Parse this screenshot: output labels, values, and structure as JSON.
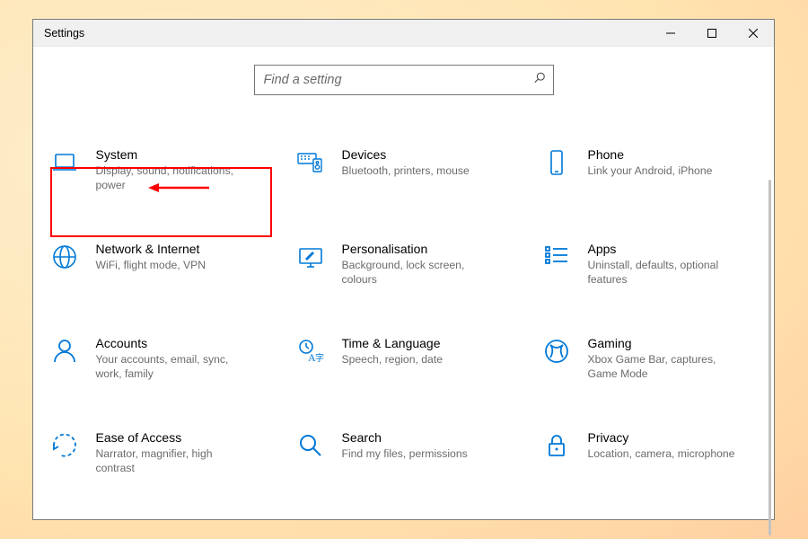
{
  "window": {
    "title": "Settings"
  },
  "search": {
    "placeholder": "Find a setting"
  },
  "tiles": [
    {
      "id": "system",
      "title": "System",
      "sub": "Display, sound, notifications, power"
    },
    {
      "id": "devices",
      "title": "Devices",
      "sub": "Bluetooth, printers, mouse"
    },
    {
      "id": "phone",
      "title": "Phone",
      "sub": "Link your Android, iPhone"
    },
    {
      "id": "network",
      "title": "Network & Internet",
      "sub": "WiFi, flight mode, VPN"
    },
    {
      "id": "personalisation",
      "title": "Personalisation",
      "sub": "Background, lock screen, colours"
    },
    {
      "id": "apps",
      "title": "Apps",
      "sub": "Uninstall, defaults, optional features"
    },
    {
      "id": "accounts",
      "title": "Accounts",
      "sub": "Your accounts, email, sync, work, family"
    },
    {
      "id": "time",
      "title": "Time & Language",
      "sub": "Speech, region, date"
    },
    {
      "id": "gaming",
      "title": "Gaming",
      "sub": "Xbox Game Bar, captures, Game Mode"
    },
    {
      "id": "ease",
      "title": "Ease of Access",
      "sub": "Narrator, magnifier, high contrast"
    },
    {
      "id": "search-cat",
      "title": "Search",
      "sub": "Find my files, permissions"
    },
    {
      "id": "privacy",
      "title": "Privacy",
      "sub": "Location, camera, microphone"
    }
  ],
  "annotations": {
    "highlight_tile": "system"
  },
  "colors": {
    "accent": "#0078d7",
    "highlight": "#ff0000"
  }
}
